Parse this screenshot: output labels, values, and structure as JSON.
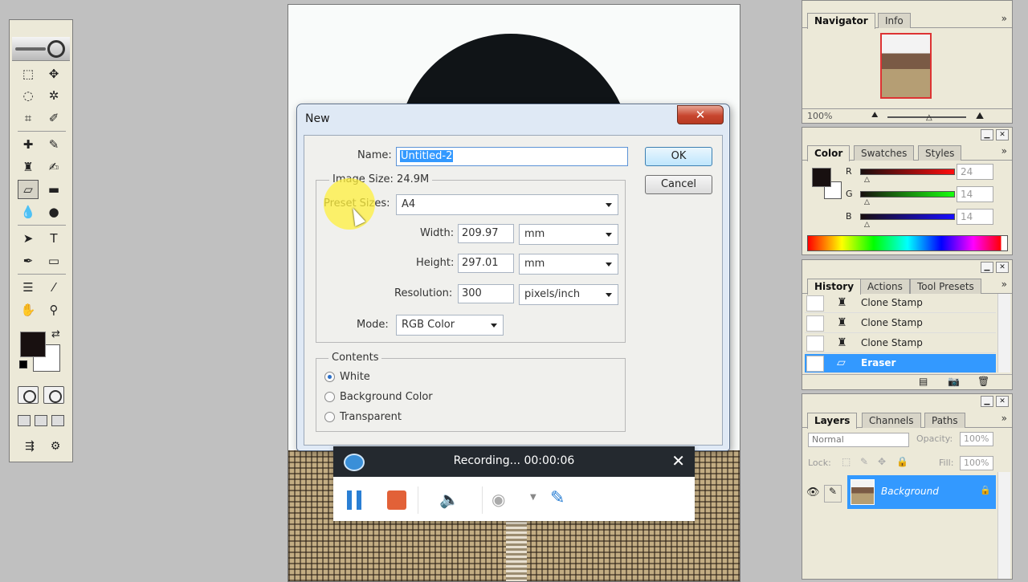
{
  "tool_icons": [
    "marquee-icon",
    "move-icon",
    "lasso-icon",
    "magic-wand-icon",
    "crop-icon",
    "slice-icon",
    "healing-icon",
    "brush-icon",
    "clone-stamp-icon",
    "history-brush-icon",
    "eraser-icon",
    "gradient-icon",
    "blur-icon",
    "dodge-icon",
    "path-select-icon",
    "type-icon",
    "pen-icon",
    "shape-icon",
    "notes-icon",
    "eyedropper-icon",
    "hand-icon",
    "zoom-icon"
  ],
  "dialog": {
    "title": "New",
    "close_label": "✕",
    "name_label": "Name:",
    "name_value": "Untitled-2",
    "image_size_label": "Image Size: 24.9M",
    "preset_label": "Preset Sizes:",
    "preset_value": "A4",
    "width_label": "Width:",
    "width_value": "209.97",
    "width_unit": "mm",
    "height_label": "Height:",
    "height_value": "297.01",
    "height_unit": "mm",
    "resolution_label": "Resolution:",
    "resolution_value": "300",
    "resolution_unit": "pixels/inch",
    "mode_label": "Mode:",
    "mode_value": "RGB Color",
    "ok_label": "OK",
    "cancel_label": "Cancel",
    "contents_title": "Contents",
    "contents_options": [
      "White",
      "Background Color",
      "Transparent"
    ],
    "contents_selected": "White"
  },
  "recorder": {
    "status": "Recording... 00:00:06",
    "close": "✕",
    "mute_icon": "🔈",
    "webcam_icon": "◉",
    "pen_icon": "✎"
  },
  "navigator": {
    "tabs": [
      "Navigator",
      "Info"
    ],
    "zoom": "100%"
  },
  "color": {
    "tabs": [
      "Color",
      "Swatches",
      "Styles"
    ],
    "channels": [
      {
        "label": "R",
        "value": "24"
      },
      {
        "label": "G",
        "value": "14"
      },
      {
        "label": "B",
        "value": "14"
      }
    ],
    "foreground": "#181010"
  },
  "history": {
    "tabs": [
      "History",
      "Actions",
      "Tool Presets"
    ],
    "items": [
      "Clone Stamp",
      "Clone Stamp",
      "Clone Stamp",
      "Eraser"
    ],
    "selected": "Eraser"
  },
  "layers": {
    "tabs": [
      "Layers",
      "Channels",
      "Paths"
    ],
    "blend_mode": "Normal",
    "opacity_label": "Opacity:",
    "opacity_value": "100%",
    "lock_label": "Lock:",
    "fill_label": "Fill:",
    "fill_value": "100%",
    "layer_name": "Background"
  }
}
